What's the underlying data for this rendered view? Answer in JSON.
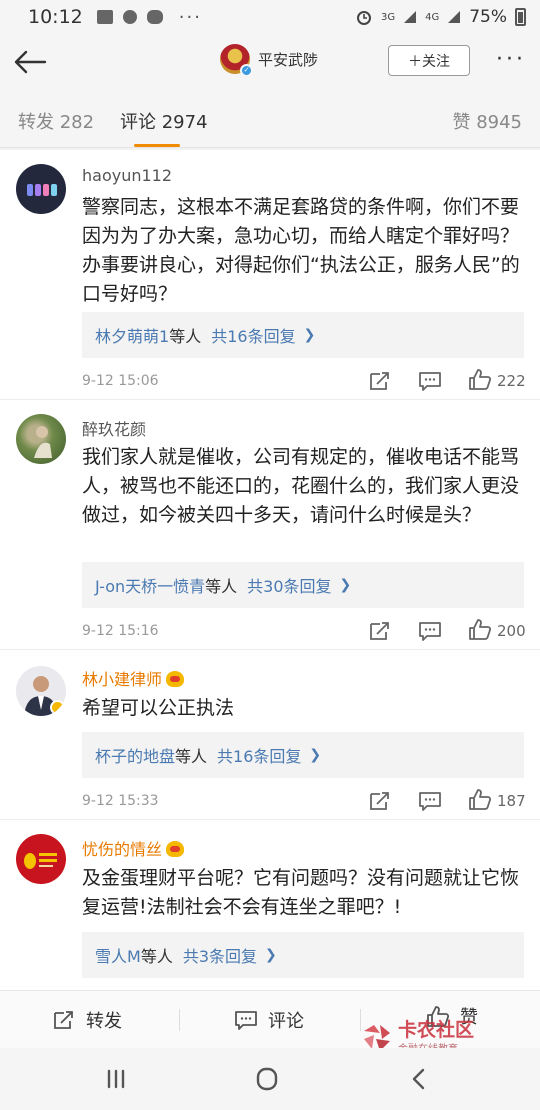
{
  "status_bar": {
    "time": "10:12",
    "more": "···",
    "sig1": "3G",
    "sig2": "4G",
    "battery": "75%"
  },
  "header": {
    "page_name": "平安武陟",
    "follow_label": "＋关注",
    "more_label": "···"
  },
  "tabs": [
    {
      "label": "转发 282"
    },
    {
      "label": "评论 2974"
    },
    {
      "label": "赞 8945"
    }
  ],
  "comments": [
    {
      "username": "haoyun112",
      "text": "警察同志，这根本不满足套路贷的条件啊，你们不要因为为了办大案，急功心切，而给人瞎定个罪好吗？办事要讲良心，对得起你们“执法公正，服务人民”的口号好吗？",
      "reply_user": "林夕萌萌1",
      "reply_mid": "等人",
      "reply_count": "共16条回复",
      "time": "9-12 15:06",
      "likes": "222"
    },
    {
      "username": "醉玖花颜",
      "text": "我们家人就是催收，公司有规定的，催收电话不能骂人，被骂也不能还口的，花圈什么的，我们家人更没做过，如今被关四十多天，请问什么时候是头？",
      "reply_user": "J-on天桥一愤青",
      "reply_mid": "等人",
      "reply_count": "共30条回复",
      "time": "9-12 15:16",
      "likes": "200"
    },
    {
      "username": "林小建律师",
      "text": "希望可以公正执法",
      "reply_user": "杯子的地盘",
      "reply_mid": "等人",
      "reply_count": "共16条回复",
      "time": "9-12 15:33",
      "likes": "187"
    },
    {
      "username": "忧伤的情丝",
      "text": "及金蛋理财平台呢？它有问题吗？没有问题就让它恢复运营!法制社会不会有连坐之罪吧？!",
      "reply_user": "雪人M",
      "reply_mid": "等人",
      "reply_count": "共3条回复"
    }
  ],
  "bottom_bar": {
    "repost": "转发",
    "comment": "评论",
    "like": "赞"
  },
  "watermark": {
    "title": "卡农社区",
    "subtitle": "金融在线教育"
  },
  "colors": {
    "accent": "#f08a00",
    "link": "#4a7ab1",
    "vip_name": "#e87a00"
  }
}
